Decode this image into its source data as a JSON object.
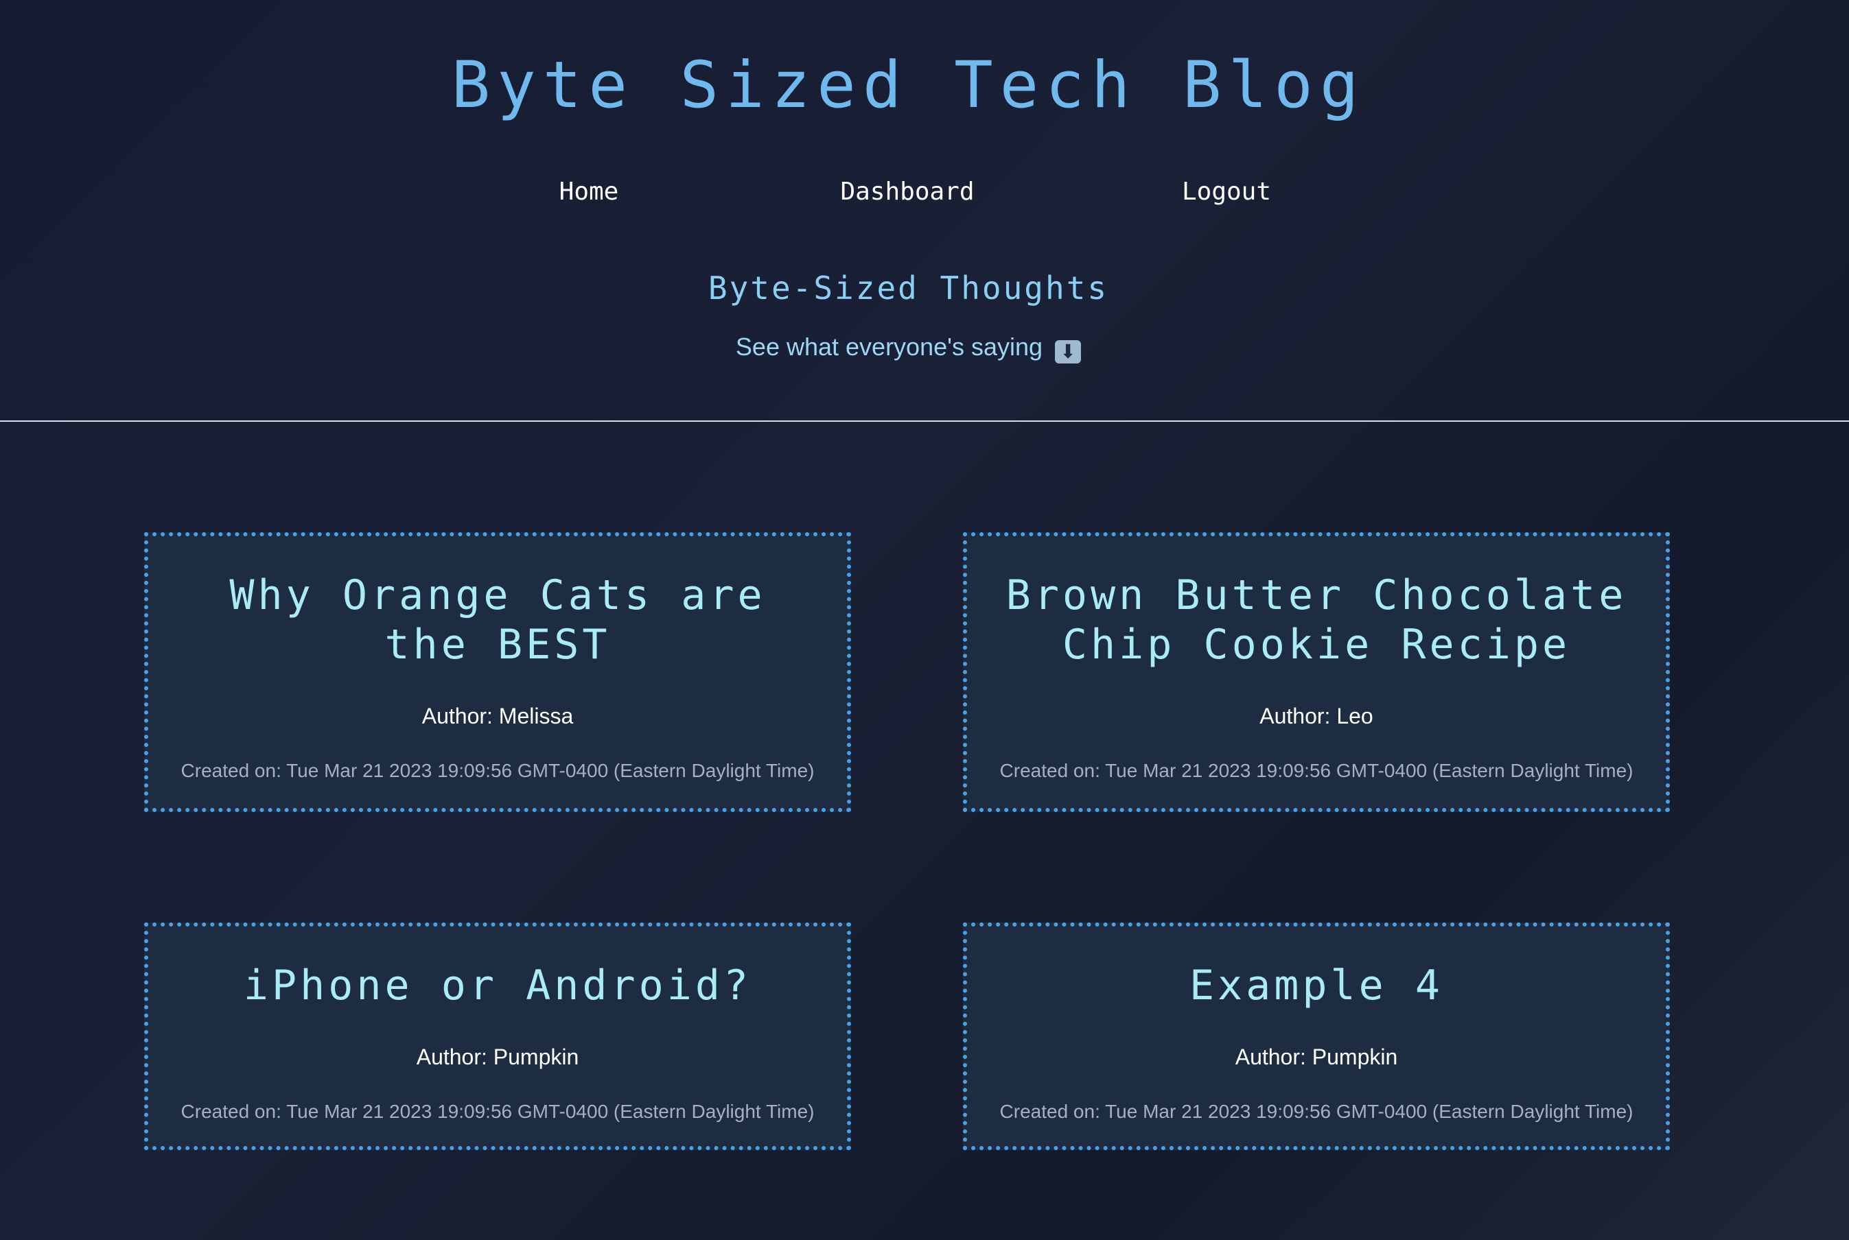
{
  "header": {
    "title": "Byte Sized Tech Blog",
    "nav": {
      "home": "Home",
      "dashboard": "Dashboard",
      "logout": "Logout"
    },
    "section_heading": "Byte-Sized Thoughts",
    "section_subtitle": "See what everyone's saying",
    "subtitle_icon": "down-arrow-emoji-icon",
    "subtitle_icon_glyph": "⬇"
  },
  "posts": [
    {
      "title": "Why Orange Cats are the BEST",
      "author": "Author: Melissa",
      "created": "Created on: Tue Mar 21 2023 19:09:56 GMT-0400 (Eastern Daylight Time)"
    },
    {
      "title": "Brown Butter Chocolate Chip Cookie Recipe",
      "author": "Author: Leo",
      "created": "Created on: Tue Mar 21 2023 19:09:56 GMT-0400 (Eastern Daylight Time)"
    },
    {
      "title": "iPhone or Android?",
      "author": "Author: Pumpkin",
      "created": "Created on: Tue Mar 21 2023 19:09:56 GMT-0400 (Eastern Daylight Time)"
    },
    {
      "title": "Example 4",
      "author": "Author: Pumpkin",
      "created": "Created on: Tue Mar 21 2023 19:09:56 GMT-0400 (Eastern Daylight Time)"
    }
  ],
  "colors": {
    "title": "#6fb9ef",
    "card_border": "#4aa2e6",
    "card_title": "#a9ecf5",
    "card_background": "#1e2c41"
  }
}
